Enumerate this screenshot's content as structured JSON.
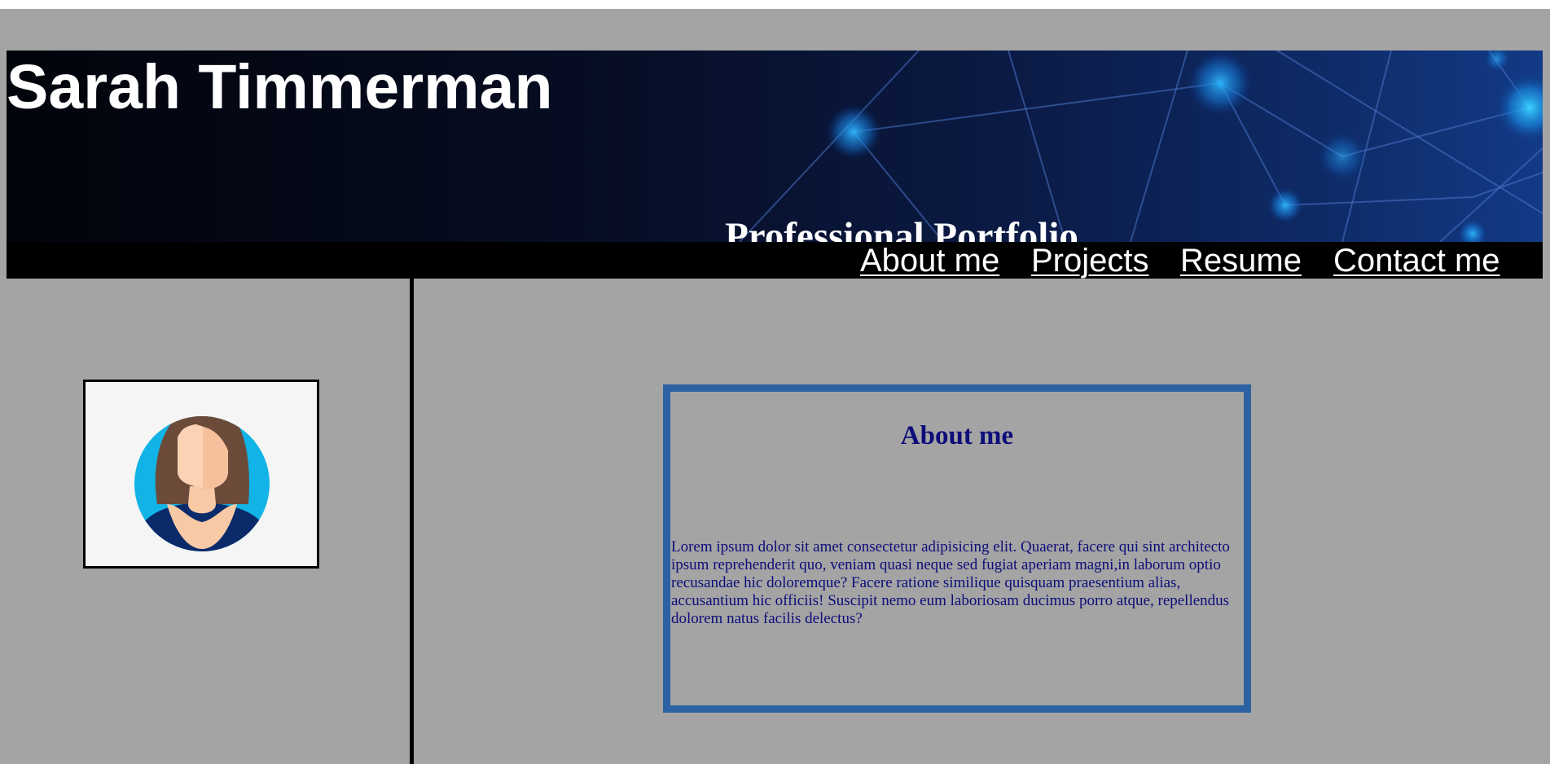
{
  "header": {
    "title": "Sarah Timmerman",
    "subtitle": "Professional Portfolio"
  },
  "nav": {
    "items": [
      {
        "label": "About me"
      },
      {
        "label": "Projects"
      },
      {
        "label": "Resume"
      },
      {
        "label": "Contact me"
      }
    ]
  },
  "sidebar": {
    "avatar_icon": "female-user-avatar-icon"
  },
  "about": {
    "heading": "About me",
    "text": "Lorem ipsum dolor sit amet consectetur adipisicing elit. Quaerat, facere qui sint architecto ipsum reprehenderit quo, veniam quasi neque sed fugiat aperiam magni,in laborum optio recusandae hic doloremque? Facere ratione similique quisquam praesentium alias, accusantium hic officiis! Suscipit nemo eum laboriosam ducimus porro atque, repellendus dolorem natus facilis delectus?"
  },
  "colors": {
    "page_background": "#a4a4a4",
    "navbar_background": "#000000",
    "card_border": "#2c62a3",
    "about_text": "#0d0d7a",
    "header_text": "#ffffff"
  }
}
